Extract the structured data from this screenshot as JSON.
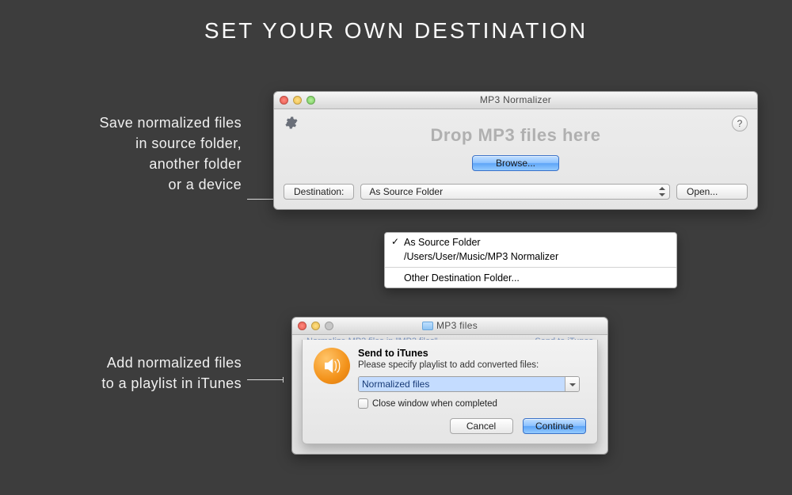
{
  "page": {
    "title": "SET YOUR OWN DESTINATION",
    "caption1_line1": "Save normalized files",
    "caption1_line2": "in source folder,",
    "caption1_line3": "another folder",
    "caption1_line4": "or a device",
    "caption2_line1": "Add normalized files",
    "caption2_line2": "to a playlist in iTunes"
  },
  "window1": {
    "title": "MP3 Normalizer",
    "dropzone": "Drop MP3 files here",
    "browse": "Browse...",
    "destination_label": "Destination:",
    "destination_selected": "As Source Folder",
    "open": "Open..."
  },
  "menu": {
    "items": [
      {
        "label": "As Source Folder",
        "checked": true
      },
      {
        "label": "/Users/User/Music/MP3 Normalizer",
        "checked": false
      }
    ],
    "other": "Other Destination Folder..."
  },
  "window2": {
    "title": "MP3 files",
    "behind_left": "Normalize MP3 files in \"MP3 files\"",
    "behind_right": "Send to iTunes",
    "sheet_title": "Send to iTunes",
    "sheet_message": "Please specify playlist to add converted files:",
    "playlist_value": "Normalized files",
    "close_when_done": "Close window when completed",
    "cancel": "Cancel",
    "continue": "Continue"
  }
}
